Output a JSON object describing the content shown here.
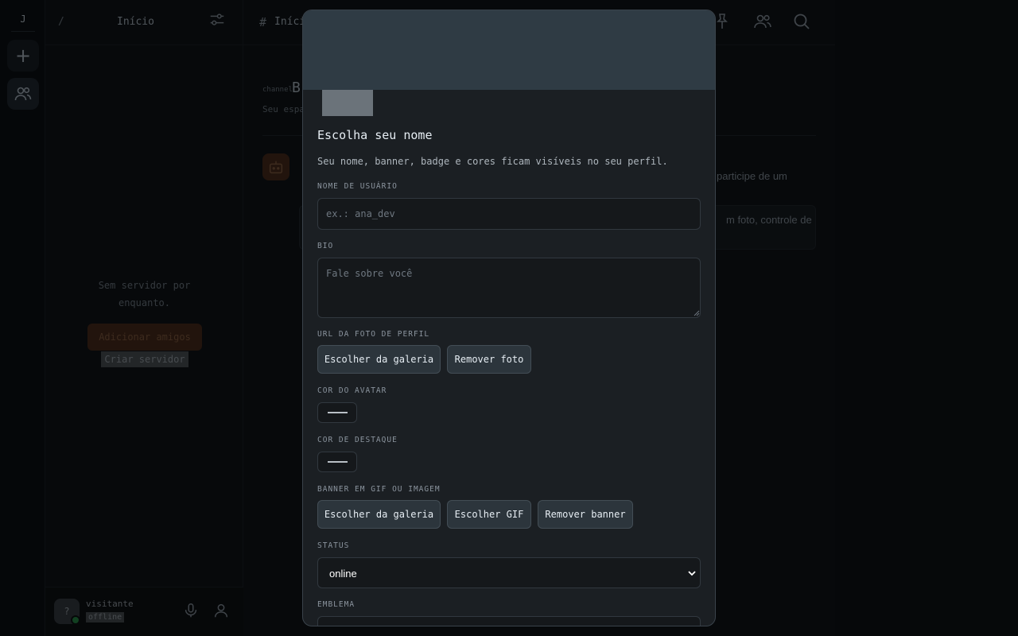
{
  "rail": {
    "server_initial": "J",
    "add_symbol": "+"
  },
  "sidebar": {
    "separator": "/",
    "title": "Início",
    "empty_line1": "Sem servidor por",
    "empty_line2": "enquanto.",
    "add_friends": "Adicionar amigos",
    "create_server": "Criar servidor",
    "user": {
      "avatar_glyph": "?",
      "name": "visitante",
      "status": "offline"
    }
  },
  "main": {
    "hash": "#",
    "title": "Início",
    "channel_label": "channel",
    "channel_name": "B",
    "channel_desc": "Seu espa",
    "message_text": "participe de um",
    "card_text": "m foto, controle de"
  },
  "modal": {
    "title": "Escolha seu nome",
    "subtitle": "Seu nome, banner, badge e cores ficam visíveis no seu perfil.",
    "username": {
      "label": "NOME DE USUÁRIO",
      "placeholder": "ex.: ana_dev",
      "value": ""
    },
    "bio": {
      "label": "BIO",
      "placeholder": "Fale sobre você",
      "value": ""
    },
    "photo": {
      "label": "URL DA FOTO DE PERFIL",
      "gallery_btn": "Escolher da galeria",
      "remove_btn": "Remover foto"
    },
    "avatar_color": {
      "label": "COR DO AVATAR"
    },
    "accent_color": {
      "label": "COR DE DESTAQUE"
    },
    "banner": {
      "label": "BANNER EM GIF OU IMAGEM",
      "gallery_btn": "Escolher da galeria",
      "gif_btn": "Escolher GIF",
      "remove_btn": "Remover banner"
    },
    "status": {
      "label": "STATUS",
      "value": "online"
    },
    "emblem": {
      "label": "EMBLEMA"
    }
  },
  "colors": {
    "accent": "#3b2417",
    "banner": "#2f3b44",
    "modal_bg": "#1b1f23",
    "online": "#1f6f3a"
  },
  "icons": [
    "plus-icon",
    "friends-icon",
    "filter-icon",
    "mic-icon",
    "person-icon",
    "pin-icon",
    "people-icon",
    "search-icon",
    "bot-icon",
    "chevron-down-icon"
  ]
}
